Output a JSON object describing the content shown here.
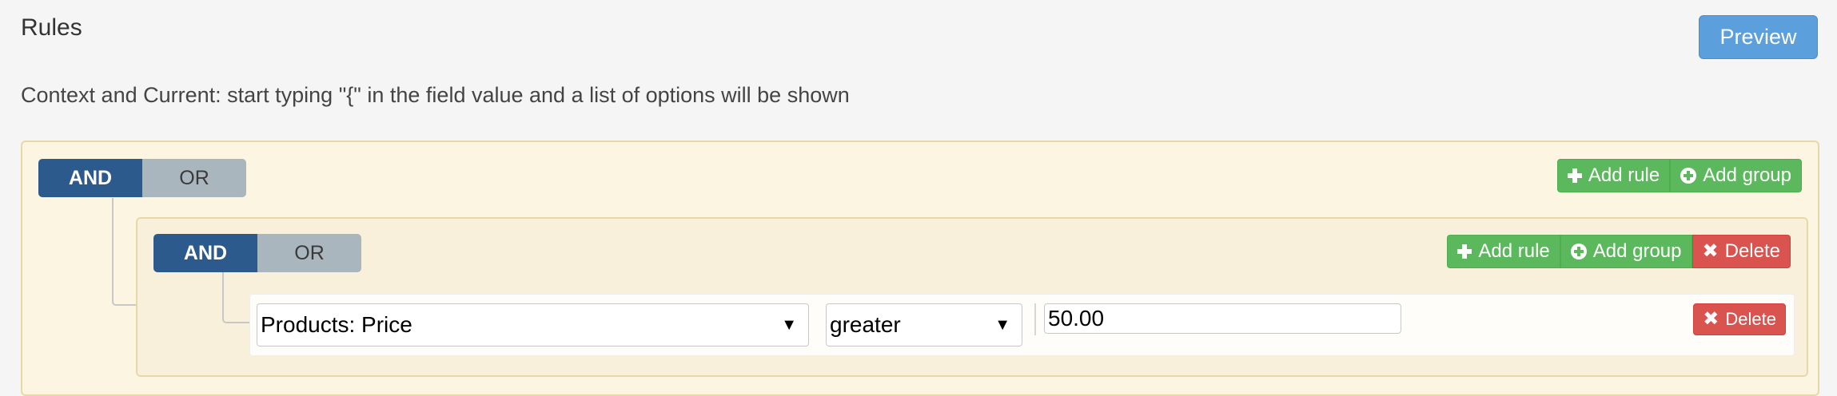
{
  "header": {
    "title": "Rules",
    "preview_label": "Preview",
    "hint": "Context and Current: start typing \"{\" in the field value and a list of options will be shown"
  },
  "root_group": {
    "conjunction_and": "AND",
    "conjunction_or": "OR",
    "selected_conjunction": "AND",
    "add_rule_label": "Add rule",
    "add_group_label": "Add group"
  },
  "nested_group": {
    "conjunction_and": "AND",
    "conjunction_or": "OR",
    "selected_conjunction": "AND",
    "add_rule_label": "Add rule",
    "add_group_label": "Add group",
    "delete_label": "Delete",
    "rule": {
      "field": "Products: Price",
      "operator": "greater",
      "value": "50.00",
      "delete_label": "Delete"
    }
  },
  "colors": {
    "primary": "#5b9fdd",
    "success": "#5cb85c",
    "danger": "#d9534f",
    "selected_conjunction": "#2d5a8c"
  }
}
